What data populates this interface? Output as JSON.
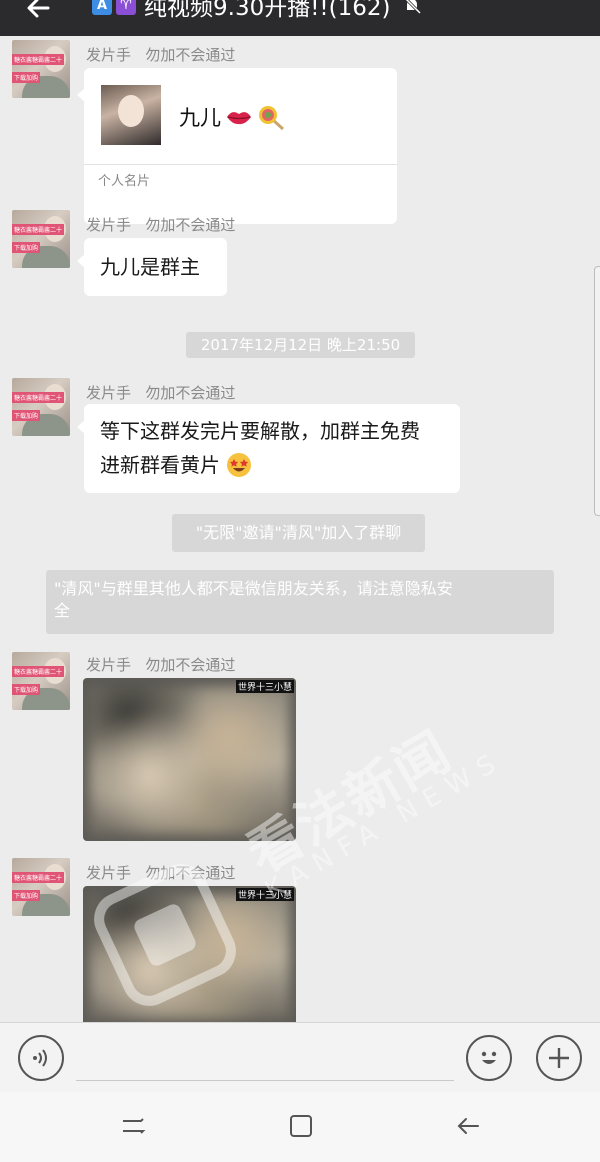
{
  "header": {
    "emoji_a": "A",
    "emoji_sym": "♈",
    "title": "纯视频9.30开播!!(162)"
  },
  "messages": [
    {
      "sender": "发片手",
      "note": "勿加不会通过",
      "type": "contact_card",
      "card_name": "九儿",
      "card_label": "个人名片"
    },
    {
      "sender": "发片手",
      "note": "勿加不会通过",
      "type": "text",
      "text": "九儿是群主"
    },
    {
      "sender": "发片手",
      "note": "勿加不会通过",
      "type": "text",
      "text_line1": "等下这群发完片要解散，加群主免费",
      "text_line2": "进新群看黄片"
    },
    {
      "sender": "发片手",
      "note": "勿加不会通过",
      "type": "image"
    },
    {
      "sender": "发片手",
      "note": "勿加不会通过",
      "type": "image"
    }
  ],
  "timestamp": "2017年12月12日 晚上21:50",
  "system_messages": {
    "invite": "\"无限\"邀请\"清风\"加入了群聊",
    "warning_line1": "\"清风\"与群里其他人都不是微信朋友关系，请注意隐私安",
    "warning_line2": "全"
  },
  "media_label": "世界十三小慧",
  "avatar_label_1": "糖衣酱糖霸酱二十",
  "avatar_label_2": "下载加购",
  "watermark": {
    "zh": "看法新闻",
    "en": "KANFA NEWS"
  },
  "input": {
    "placeholder": ""
  },
  "icons": {
    "back": "back-arrow-icon",
    "mute": "mute-bell-icon",
    "voice": "voice-icon",
    "emoji": "emoji-icon",
    "plus": "plus-icon",
    "recent": "recent-apps-icon",
    "home": "home-icon",
    "nav_back": "nav-back-icon"
  }
}
